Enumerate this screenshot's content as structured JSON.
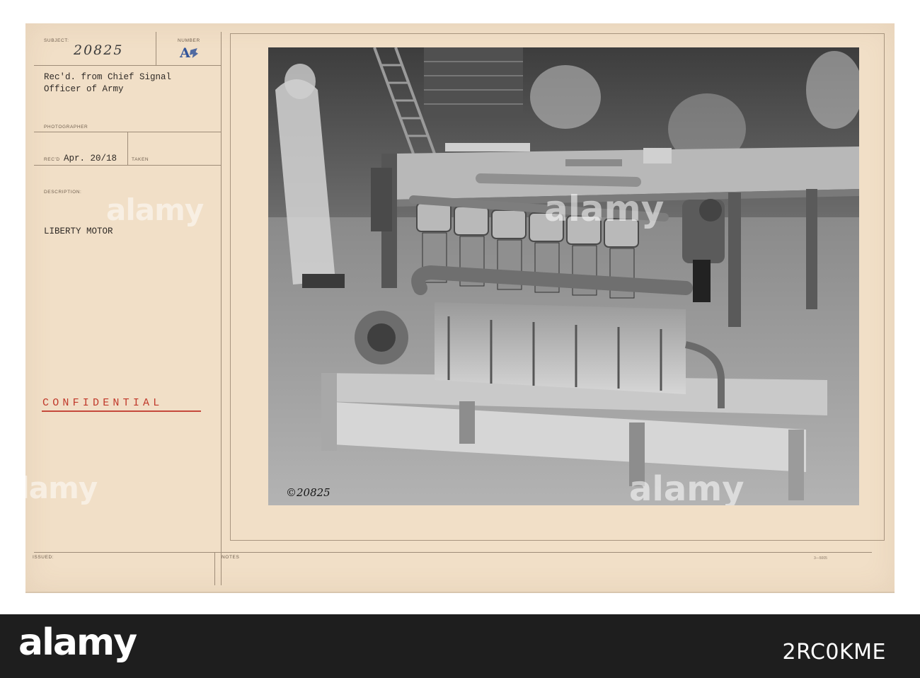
{
  "card": {
    "subject_label": "SUBJECT:",
    "subject_value": "20825",
    "number_label": "NUMBER",
    "number_value": "A",
    "received_from": [
      "Rec'd. from Chief Signal",
      "Officer of Army"
    ],
    "photographer_label": "PHOTOGRAPHER",
    "recd_label": "REC'D",
    "recd_value": "Apr. 20/18",
    "taken_label": "TAKEN",
    "description_label": "DESCRIPTION:",
    "description_value": "LIBERTY MOTOR",
    "stamp": "CONFIDENTIAL",
    "issued_label": "ISSUED:",
    "notes_label": "NOTES",
    "form_code": "3—5005"
  },
  "photo": {
    "handwritten_number": "©20825",
    "watermark": "alamy"
  },
  "bottom_band": {
    "logo": "alamy",
    "image_code": "2RC0KME"
  }
}
